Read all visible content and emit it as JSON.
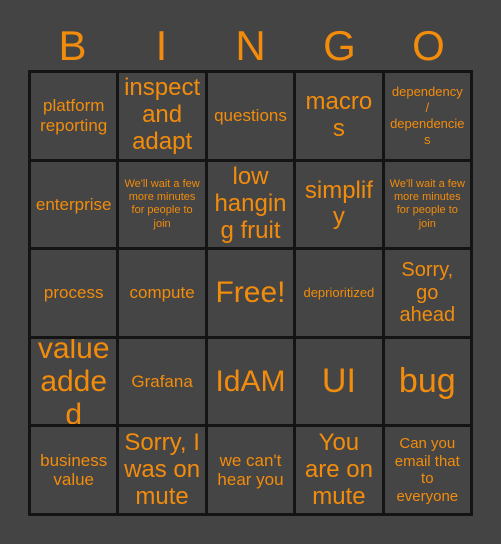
{
  "card": {
    "title": "BINGO",
    "accent_color": "#F28C0C",
    "background_color": "#444444",
    "cell_background_color": "#454545",
    "border_color": "#141414"
  },
  "header": {
    "letters": [
      "B",
      "I",
      "N",
      "G",
      "O"
    ]
  },
  "grid": {
    "columns": 5,
    "rows": 5,
    "cells": [
      {
        "text": "platform reporting",
        "size": "m",
        "free": false
      },
      {
        "text": "inspect and adapt",
        "size": "xl",
        "free": false
      },
      {
        "text": "questions",
        "size": "m",
        "free": false
      },
      {
        "text": "macros",
        "size": "xl",
        "free": false
      },
      {
        "text": "dependency / dependencies",
        "size": "xs",
        "free": false
      },
      {
        "text": "enterprise",
        "size": "m",
        "free": false
      },
      {
        "text": "We'll wait a few more minutes for people to join",
        "size": "xxs",
        "free": false
      },
      {
        "text": "low hanging fruit",
        "size": "xl",
        "free": false
      },
      {
        "text": "simplify",
        "size": "xl",
        "free": false
      },
      {
        "text": "We'll wait a few more minutes for people to join",
        "size": "xxs",
        "free": false
      },
      {
        "text": "process",
        "size": "m",
        "free": false
      },
      {
        "text": "compute",
        "size": "m",
        "free": false
      },
      {
        "text": "Free!",
        "size": "xxl",
        "free": true
      },
      {
        "text": "deprioritized",
        "size": "xs",
        "free": false
      },
      {
        "text": "Sorry, go ahead",
        "size": "l",
        "free": false
      },
      {
        "text": "value added",
        "size": "xxl",
        "free": false
      },
      {
        "text": "Grafana",
        "size": "m",
        "free": false
      },
      {
        "text": "IdAM",
        "size": "xxl",
        "free": false
      },
      {
        "text": "UI",
        "size": "huge",
        "free": false
      },
      {
        "text": "bug",
        "size": "huge",
        "free": false
      },
      {
        "text": "business value",
        "size": "m",
        "free": false
      },
      {
        "text": "Sorry, I was on mute",
        "size": "xl",
        "free": false
      },
      {
        "text": "we can't hear you",
        "size": "m",
        "free": false
      },
      {
        "text": "You are on mute",
        "size": "xl",
        "free": false
      },
      {
        "text": "Can you email that to everyone",
        "size": "s",
        "free": false
      }
    ]
  }
}
